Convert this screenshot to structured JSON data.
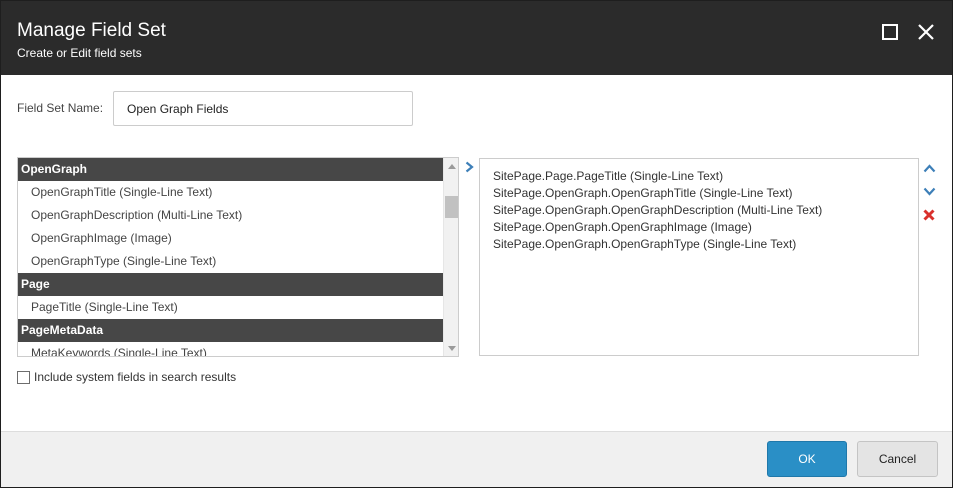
{
  "dialog": {
    "title": "Manage Field Set",
    "subtitle": "Create or Edit field sets"
  },
  "form": {
    "field_set_name_label": "Field Set Name:",
    "field_set_name_value": "Open Graph Fields"
  },
  "available_fields": {
    "groups": [
      {
        "name": "OpenGraph",
        "items": [
          "OpenGraphTitle (Single-Line Text)",
          "OpenGraphDescription (Multi-Line Text)",
          "OpenGraphImage (Image)",
          "OpenGraphType (Single-Line Text)"
        ]
      },
      {
        "name": "Page",
        "items": [
          "PageTitle (Single-Line Text)"
        ]
      },
      {
        "name": "PageMetaData",
        "items": [
          "MetaKeywords (Single-Line Text)"
        ]
      }
    ]
  },
  "selected_fields": [
    "SitePage.Page.PageTitle (Single-Line Text)",
    "SitePage.OpenGraph.OpenGraphTitle (Single-Line Text)",
    "SitePage.OpenGraph.OpenGraphDescription (Multi-Line Text)",
    "SitePage.OpenGraph.OpenGraphImage (Image)",
    "SitePage.OpenGraph.OpenGraphType (Single-Line Text)"
  ],
  "options": {
    "include_system_fields_label": "Include system fields in search results"
  },
  "buttons": {
    "ok_label": "OK",
    "cancel_label": "Cancel"
  },
  "icons": {
    "maximize": "maximize-icon",
    "close": "close-icon",
    "add": "chevron-right-icon",
    "move_up": "chevron-up-icon",
    "move_down": "chevron-down-icon",
    "remove": "remove-x-icon"
  },
  "colors": {
    "titlebar": "#2b2b2b",
    "group_header": "#474747",
    "accent_blue": "#2a8fc6",
    "remove_red": "#d9302c",
    "arrow_blue": "#3d7fb8"
  }
}
